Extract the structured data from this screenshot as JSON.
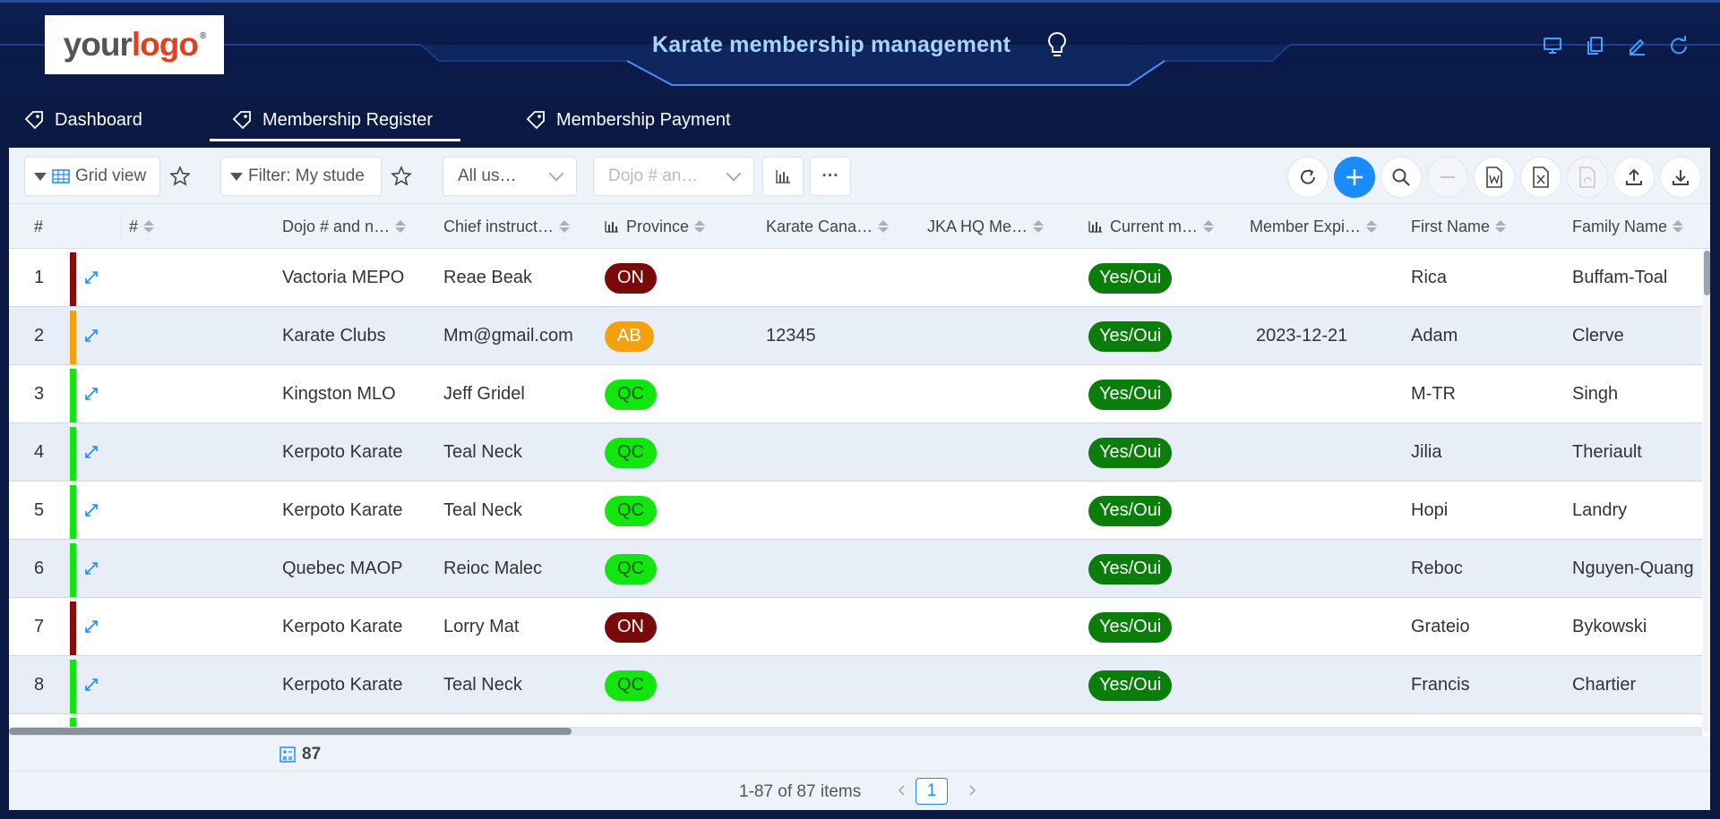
{
  "header": {
    "logo_text_1": "your",
    "logo_text_2": "logo",
    "logo_mark": "®",
    "title": "Karate membership management",
    "icons": [
      "desktop-icon",
      "copy-icon",
      "edit-icon",
      "refresh-icon"
    ]
  },
  "tabs": [
    {
      "label": "Dashboard",
      "active": false
    },
    {
      "label": "Membership Register",
      "active": true
    },
    {
      "label": "Membership Payment",
      "active": false
    }
  ],
  "toolbar": {
    "view_label": "Grid view",
    "filter_label": "Filter: My stude",
    "users_select": "All us…",
    "dojo_placeholder": "Dojo # an…",
    "more_label": "···"
  },
  "columns": [
    {
      "key": "rownum",
      "label": "#",
      "sortable": false
    },
    {
      "key": "id",
      "label": "#",
      "sortable": true
    },
    {
      "key": "dojo",
      "label": "Dojo # and n…",
      "sortable": true
    },
    {
      "key": "instructor",
      "label": "Chief instruct…",
      "sortable": true
    },
    {
      "key": "province",
      "label": "Province",
      "sortable": true,
      "chart": true
    },
    {
      "key": "karate_canada",
      "label": "Karate Cana…",
      "sortable": true
    },
    {
      "key": "jka",
      "label": "JKA HQ Me…",
      "sortable": true
    },
    {
      "key": "current",
      "label": "Current m…",
      "sortable": true,
      "chart": true
    },
    {
      "key": "expiry",
      "label": "Member Expi…",
      "sortable": true
    },
    {
      "key": "first",
      "label": "First Name",
      "sortable": true
    },
    {
      "key": "family",
      "label": "Family Name",
      "sortable": true
    }
  ],
  "province_colors": {
    "ON": {
      "bg": "#7a0a0a",
      "fg": "#ffffff"
    },
    "AB": {
      "bg": "#f5a00f",
      "fg": "#ffffff"
    },
    "QC": {
      "bg": "#13e60f",
      "fg": "#0d5e0d"
    }
  },
  "rows": [
    {
      "n": "1",
      "dojo": "Vactoria MEPO",
      "instructor": "Reae Beak",
      "province": "ON",
      "karate_canada": "",
      "jka": "",
      "current": "Yes/Oui",
      "expiry": "",
      "first": "Rica",
      "family": "Buffam-Toal",
      "bar": "#8b0a0a"
    },
    {
      "n": "2",
      "dojo": "Karate Clubs",
      "instructor": "Mm@gmail.com",
      "province": "AB",
      "karate_canada": "12345",
      "jka": "",
      "current": "Yes/Oui",
      "expiry": "2023-12-21",
      "first": "Adam",
      "family": "Clerve",
      "bar": "#f5a00f"
    },
    {
      "n": "3",
      "dojo": "Kingston MLO",
      "instructor": "Jeff Gridel",
      "province": "QC",
      "karate_canada": "",
      "jka": "",
      "current": "Yes/Oui",
      "expiry": "",
      "first": "M-TR",
      "family": "Singh",
      "bar": "#13e60f"
    },
    {
      "n": "4",
      "dojo": "Kerpoto Karate",
      "instructor": "Teal Neck",
      "province": "QC",
      "karate_canada": "",
      "jka": "",
      "current": "Yes/Oui",
      "expiry": "",
      "first": "Jilia",
      "family": "Theriault",
      "bar": "#13e60f"
    },
    {
      "n": "5",
      "dojo": "Kerpoto Karate",
      "instructor": "Teal Neck",
      "province": "QC",
      "karate_canada": "",
      "jka": "",
      "current": "Yes/Oui",
      "expiry": "",
      "first": "Hopi",
      "family": "Landry",
      "bar": "#13e60f"
    },
    {
      "n": "6",
      "dojo": "Quebec MAOP",
      "instructor": "Reioc Malec",
      "province": "QC",
      "karate_canada": "",
      "jka": "",
      "current": "Yes/Oui",
      "expiry": "",
      "first": "Reboc",
      "family": "Nguyen-Quang",
      "bar": "#13e60f"
    },
    {
      "n": "7",
      "dojo": "Kerpoto Karate",
      "instructor": "Lorry Mat",
      "province": "ON",
      "karate_canada": "",
      "jka": "",
      "current": "Yes/Oui",
      "expiry": "",
      "first": "Grateio",
      "family": "Bykowski",
      "bar": "#8b0a0a"
    },
    {
      "n": "8",
      "dojo": "Kerpoto Karate",
      "instructor": "Teal Neck",
      "province": "QC",
      "karate_canada": "",
      "jka": "",
      "current": "Yes/Oui",
      "expiry": "",
      "first": "Francis",
      "family": "Chartier",
      "bar": "#13e60f"
    }
  ],
  "summary": {
    "count": "87"
  },
  "pagination": {
    "info": "1-87 of 87 items",
    "current_page": "1"
  },
  "colors": {
    "accent": "#1a8cff",
    "header_bg": "#0c1f52",
    "title": "#a8d4ff",
    "yes_badge": "#0a7d0a"
  }
}
